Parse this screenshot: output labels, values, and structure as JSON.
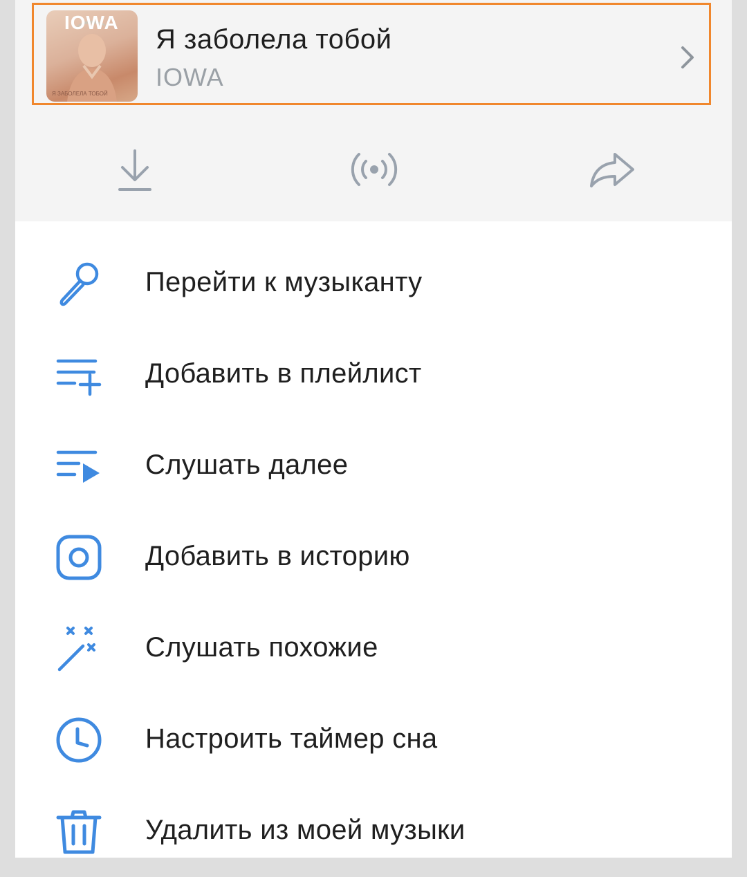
{
  "track": {
    "title": "Я заболела тобой",
    "artist": "IOWA",
    "cover_logo": "IOWA",
    "cover_caption": "Я ЗАБОЛЕЛА ТОБОЙ"
  },
  "actions": [
    {
      "icon": "download-icon"
    },
    {
      "icon": "broadcast-icon"
    },
    {
      "icon": "share-icon"
    }
  ],
  "menu": {
    "items": [
      {
        "label": "Перейти к музыканту",
        "icon": "microphone-icon"
      },
      {
        "label": "Добавить в плейлист",
        "icon": "playlist-add-icon"
      },
      {
        "label": "Слушать далее",
        "icon": "play-next-icon"
      },
      {
        "label": "Добавить в историю",
        "icon": "instagram-icon"
      },
      {
        "label": "Слушать похожие",
        "icon": "magic-wand-icon"
      },
      {
        "label": "Настроить таймер сна",
        "icon": "clock-icon"
      },
      {
        "label": "Удалить из моей музыки",
        "icon": "trash-icon"
      }
    ]
  },
  "colors": {
    "accent": "#3f8ae0",
    "highlight_border": "#f0872d",
    "header_bg": "#f4f4f4",
    "secondary_text": "#9aa0a6",
    "icon_gray": "#99a2ad"
  }
}
